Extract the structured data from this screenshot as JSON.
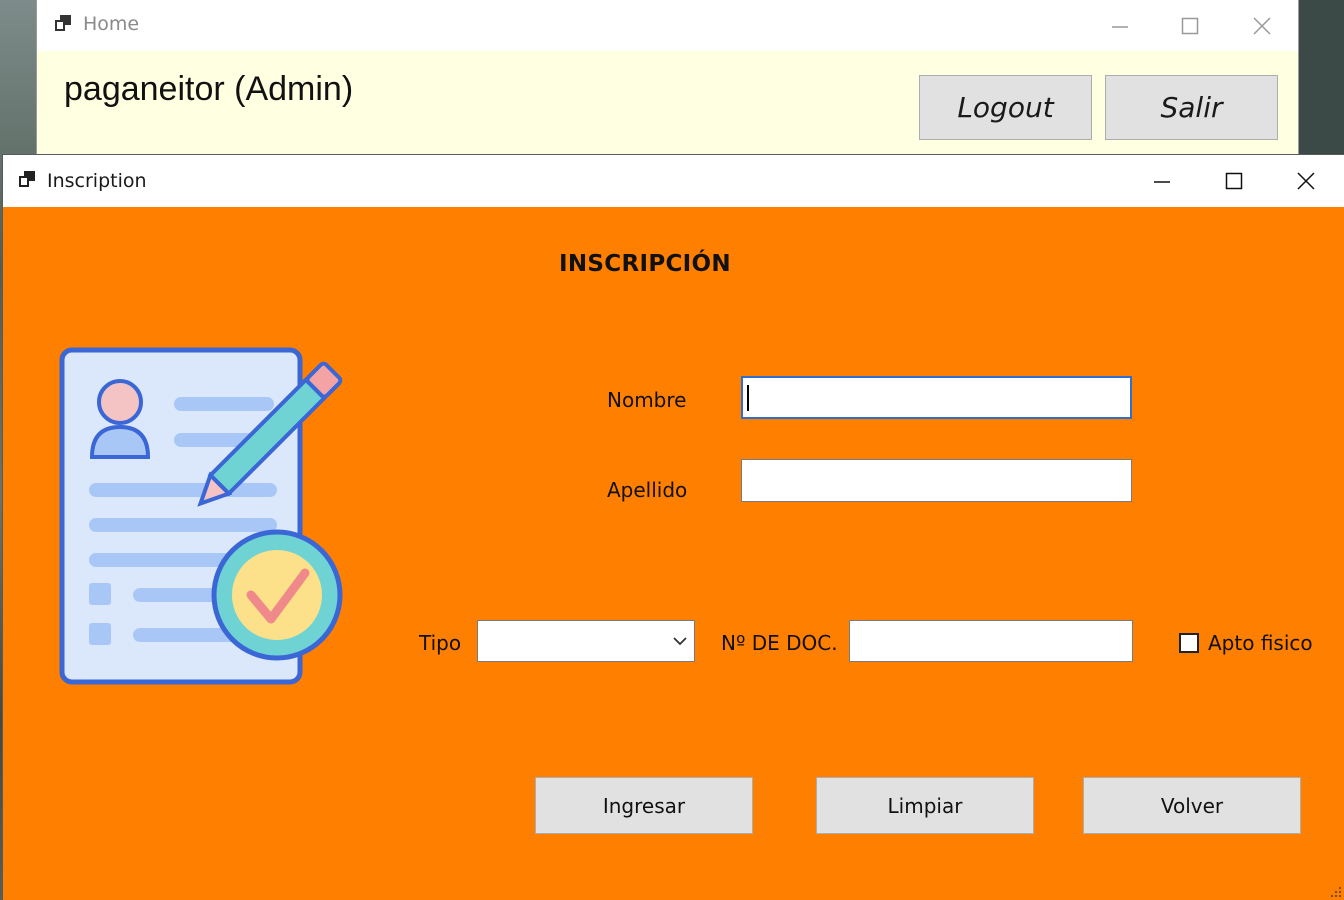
{
  "home_window": {
    "title": "Home",
    "user_label": "paganeitor (Admin)",
    "logout_label": "Logout",
    "salir_label": "Salir",
    "background_color": "#ffffe1"
  },
  "inscription_window": {
    "title": "Inscription",
    "heading": "INSCRIPCIÓN",
    "background_color": "#ff8000",
    "form": {
      "nombre_label": "Nombre",
      "nombre_value": "",
      "apellido_label": "Apellido",
      "apellido_value": "",
      "tipo_label": "Tipo",
      "tipo_selected": "",
      "doc_label": "Nº DE DOC.",
      "doc_value": "",
      "apto_label": "Apto fisico",
      "apto_checked": false
    },
    "buttons": {
      "ingresar": "Ingresar",
      "limpiar": "Limpiar",
      "volver": "Volver"
    },
    "illustration_icon": "registration-form-checkmark-icon"
  }
}
